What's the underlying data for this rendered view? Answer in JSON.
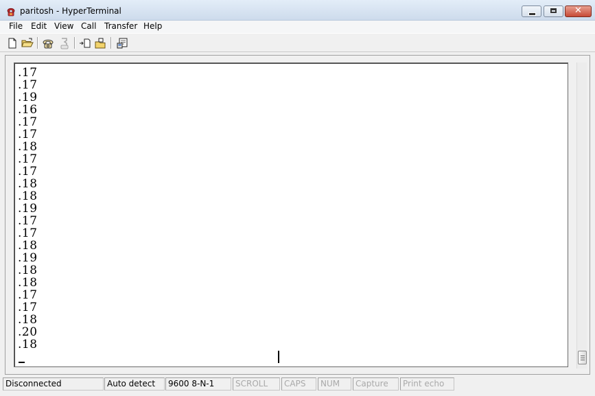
{
  "window": {
    "title": "paritosh - HyperTerminal",
    "app_icon": "hyperterminal-phone-icon",
    "controls": {
      "minimize_icon": "minimize-icon",
      "maximize_icon": "maximize-icon",
      "close_label": "✕"
    }
  },
  "menubar": {
    "items": [
      {
        "label": "File"
      },
      {
        "label": "Edit"
      },
      {
        "label": "View"
      },
      {
        "label": "Call"
      },
      {
        "label": "Transfer"
      },
      {
        "label": "Help"
      }
    ]
  },
  "toolbar": {
    "buttons": [
      {
        "icon": "new-document-icon"
      },
      {
        "icon": "open-folder-icon"
      },
      {
        "icon": "connect-phone-icon"
      },
      {
        "icon": "disconnect-phone-icon"
      },
      {
        "icon": "send-file-icon"
      },
      {
        "icon": "receive-file-icon"
      },
      {
        "icon": "properties-icon"
      }
    ]
  },
  "terminal": {
    "lines": [
      ".17",
      ".17",
      ".19",
      ".16",
      ".17",
      ".17",
      ".18",
      ".17",
      ".17",
      ".18",
      ".18",
      ".19",
      ".17",
      ".17",
      ".18",
      ".19",
      ".18",
      ".18",
      ".17",
      ".17",
      ".18",
      ".20",
      ".18"
    ]
  },
  "statusbar": {
    "connection": "Disconnected",
    "detect": "Auto detect",
    "port_settings": "9600 8-N-1",
    "scroll": "SCROLL",
    "caps": "CAPS",
    "num": "NUM",
    "capture": "Capture",
    "print_echo": "Print echo"
  },
  "colors": {
    "titlebar": "#d6e3f2",
    "close_button": "#c74a36",
    "terminal_background": "#ffffff",
    "disabled_status_text": "#a9a9a9"
  }
}
